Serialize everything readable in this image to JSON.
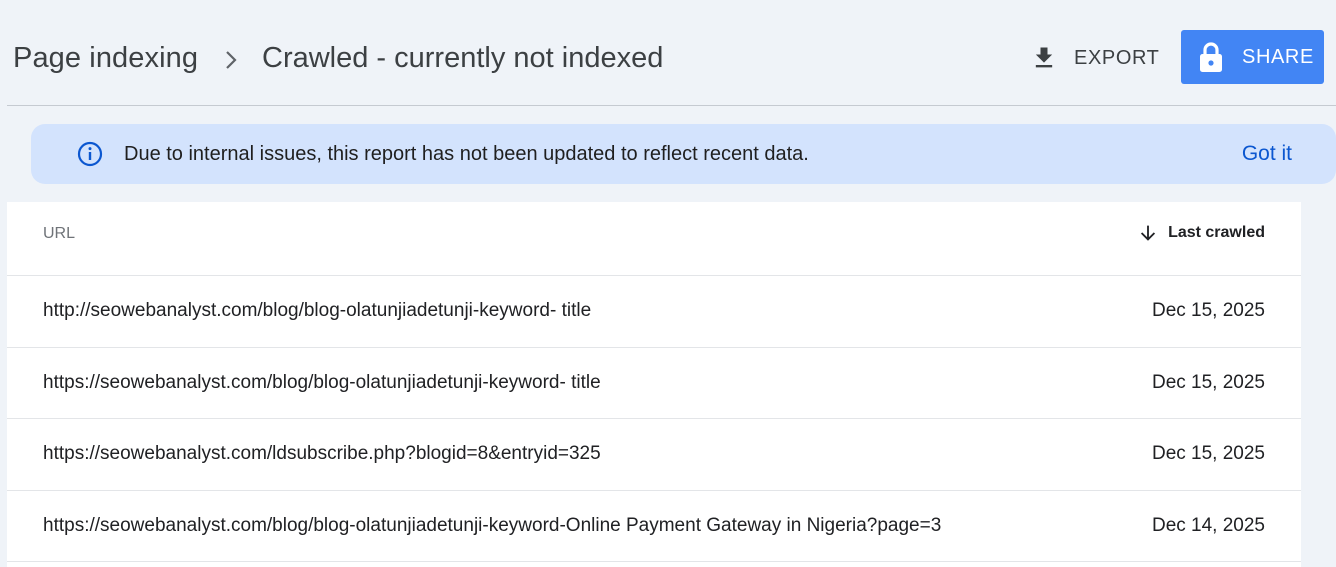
{
  "header": {
    "breadcrumb_root": "Page indexing",
    "breadcrumb_current": "Crawled - currently not indexed",
    "export_label": "EXPORT",
    "share_label": "SHARE"
  },
  "banner": {
    "message": "Due to internal issues, this report has not been updated to reflect recent data.",
    "dismiss_label": "Got it"
  },
  "table": {
    "columns": {
      "url": "URL",
      "last_crawled": "Last crawled"
    },
    "sort": "descending",
    "rows": [
      {
        "url": "http://seowebanalyst.com/blog/blog-olatunjiadetunji-keyword- title",
        "date": "Dec 15, 2025"
      },
      {
        "url": "https://seowebanalyst.com/blog/blog-olatunjiadetunji-keyword- title",
        "date": "Dec 15, 2025"
      },
      {
        "url": "https://seowebanalyst.com/ldsubscribe.php?blogid=8&entryid=325",
        "date": "Dec 15, 2025"
      },
      {
        "url": "https://seowebanalyst.com/blog/blog-olatunjiadetunji-keyword-Online Payment Gateway in Nigeria?page=3",
        "date": "Dec 14, 2025"
      }
    ]
  },
  "colors": {
    "page_bg": "#eff3f8",
    "share_button": "#4285f4",
    "banner_bg": "#d3e3fd",
    "link_blue": "#0b57d0"
  },
  "icons": {
    "breadcrumb_separator": "chevron-right-icon",
    "export": "download-icon",
    "share": "lock-icon",
    "banner": "info-icon",
    "sort": "arrow-down-icon"
  }
}
